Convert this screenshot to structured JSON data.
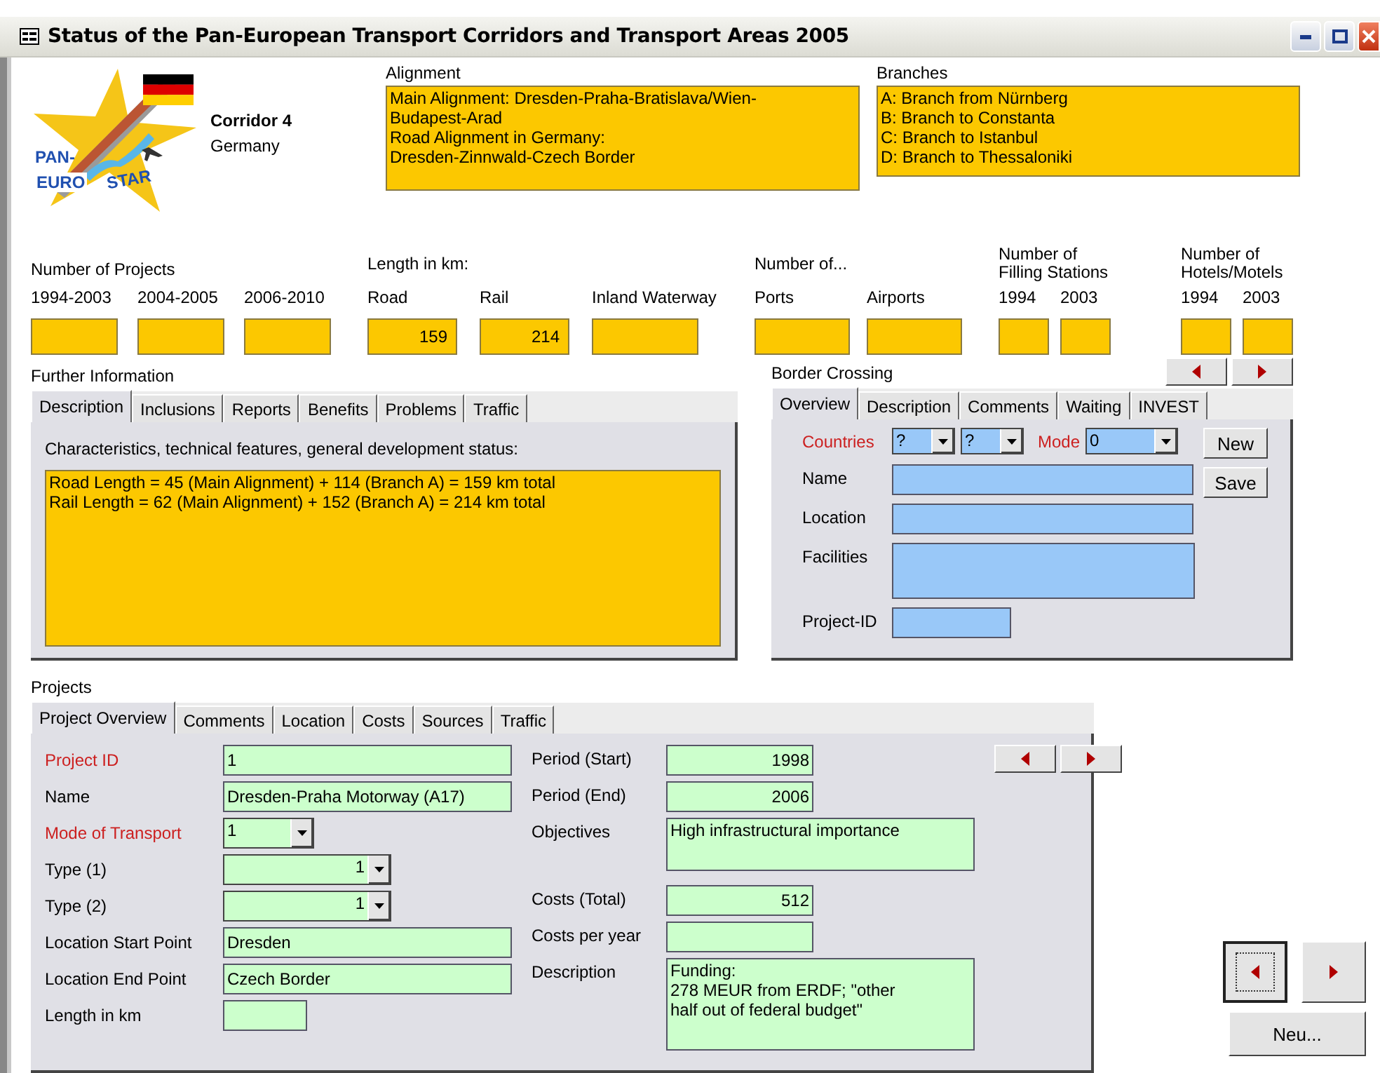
{
  "window": {
    "title": "Status of the Pan-European Transport Corridors and Transport Areas 2005"
  },
  "logo": {
    "words": [
      "PAN-",
      "EURO",
      "STAR"
    ]
  },
  "corridor": {
    "name": "Corridor 4",
    "country": "Germany"
  },
  "alignment": {
    "label": "Alignment",
    "text": "Main Alignment: Dresden-Praha-Bratislava/Wien-Budapest-Arad\nRoad Alignment in Germany:\nDresden-Zinnwald-Czech Border"
  },
  "branches": {
    "label": "Branches",
    "text": "A: Branch from Nürnberg\nB: Branch to Constanta\nC: Branch to Istanbul\nD: Branch to Thessaloniki"
  },
  "stat_groups": [
    {
      "label": "Number of Projects",
      "fields": [
        {
          "label": "1994-2003"
        },
        {
          "label": "2004-2005"
        },
        {
          "label": "2006-2010"
        }
      ]
    },
    {
      "label": "Length in km:",
      "fields": [
        {
          "label": "Road",
          "value": "159"
        },
        {
          "label": "Rail",
          "value": "214"
        },
        {
          "label": "Inland Waterway"
        }
      ]
    },
    {
      "label": "Number of...",
      "fields": [
        {
          "label": "Ports"
        },
        {
          "label": "Airports"
        }
      ]
    },
    {
      "label": "Number of Filling Stations",
      "fields": [
        {
          "label": "1994"
        },
        {
          "label": "2003"
        }
      ]
    },
    {
      "label": "Number of Hotels/Motels",
      "fields": [
        {
          "label": "1994"
        },
        {
          "label": "2003"
        }
      ]
    }
  ],
  "further_information": {
    "label": "Further Information",
    "tabs": [
      {
        "label": "Description",
        "selected": true
      },
      {
        "label": "Inclusions",
        "selected": false
      },
      {
        "label": "Reports",
        "selected": false
      },
      {
        "label": "Benefits",
        "selected": false
      },
      {
        "label": "Problems",
        "selected": false
      },
      {
        "label": "Traffic",
        "selected": false
      }
    ],
    "caption": "Characteristics, technical features, general development status:",
    "text": "Road Length = 45 (Main Alignment) + 114 (Branch A) = 159 km total\nRail Length = 62 (Main Alignment) + 152 (Branch A) = 214 km total"
  },
  "border_crossing": {
    "label": "Border Crossing",
    "tabs": [
      {
        "label": "Overview",
        "selected": true
      },
      {
        "label": "Description",
        "selected": false
      },
      {
        "label": "Comments",
        "selected": false
      },
      {
        "label": "Waiting",
        "selected": false
      },
      {
        "label": "INVEST",
        "selected": false
      }
    ],
    "countries_label": "Countries",
    "countries": [
      "?",
      "?"
    ],
    "mode_label": "Mode",
    "mode": "0",
    "buttons": [
      "New",
      "Save"
    ],
    "fields": [
      {
        "label": "Name",
        "kind": "text"
      },
      {
        "label": "Location",
        "kind": "text"
      },
      {
        "label": "Facilities",
        "kind": "memo"
      },
      {
        "label": "Project-ID",
        "kind": "short"
      }
    ]
  },
  "projects": {
    "label": "Projects",
    "tabs": [
      {
        "label": "Project Overview",
        "selected": true
      },
      {
        "label": "Comments",
        "selected": false
      },
      {
        "label": "Location",
        "selected": false
      },
      {
        "label": "Costs",
        "selected": false
      },
      {
        "label": "Sources",
        "selected": false
      },
      {
        "label": "Traffic",
        "selected": false
      }
    ],
    "left_fields": [
      {
        "label": "Project ID",
        "required": true,
        "kind": "text",
        "value": "1"
      },
      {
        "label": "Name",
        "required": false,
        "kind": "text",
        "value": "Dresden-Praha Motorway (A17)"
      },
      {
        "label": "Mode of Transport",
        "required": true,
        "kind": "combo",
        "value": "1"
      },
      {
        "label": "Type (1)",
        "required": false,
        "kind": "combo_number",
        "value": "1"
      },
      {
        "label": "Type (2)",
        "required": false,
        "kind": "combo_number",
        "value": "1"
      },
      {
        "label": "Location Start Point",
        "required": false,
        "kind": "text",
        "value": "Dresden"
      },
      {
        "label": "Location End Point",
        "required": false,
        "kind": "text",
        "value": "Czech Border"
      },
      {
        "label": "Length in km",
        "required": false,
        "kind": "short"
      }
    ],
    "right_fields": [
      {
        "label": "Period (Start)",
        "kind": "number",
        "value": "1998"
      },
      {
        "label": "Period (End)",
        "kind": "number",
        "value": "2006"
      },
      {
        "label": "Objectives",
        "kind": "memo",
        "value": "High infrastructural importance"
      },
      {
        "label": "Costs (Total)",
        "kind": "number",
        "value": "512"
      },
      {
        "label": "Costs per year",
        "kind": "number"
      },
      {
        "label": "Description",
        "kind": "memo_large",
        "value": "Funding:\n278 MEUR from ERDF; \"other\nhalf out of federal budget\""
      }
    ]
  },
  "record_nav": {
    "buttons": [
      {
        "kind": "previous",
        "focused": true
      },
      {
        "kind": "next",
        "focused": false
      }
    ],
    "new_label": "Neu..."
  }
}
